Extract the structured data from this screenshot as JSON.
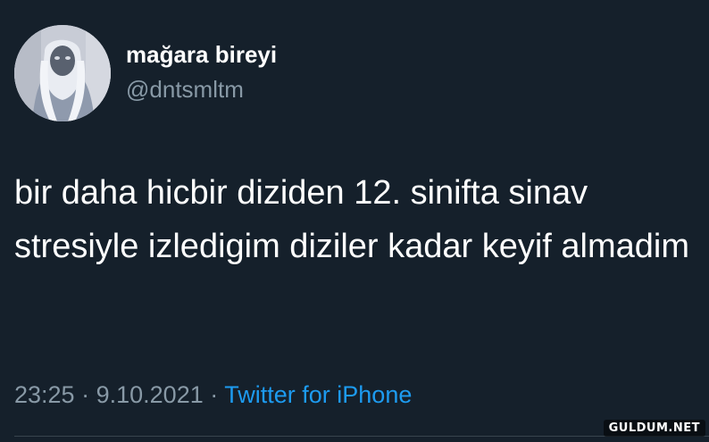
{
  "tweet": {
    "author": {
      "display_name": "mağara bireyi",
      "handle": "@dntsmltm"
    },
    "text": "bir daha hicbir diziden 12. sinifta sinav stresiyle izledigim diziler kadar keyif almadim",
    "time": "23:25",
    "separator": "·",
    "date": "9.10.2021",
    "source": "Twitter for iPhone",
    "source_color": "#1d9bf0"
  },
  "watermark": "GULDUM.NET",
  "colors": {
    "background": "#15202b",
    "text": "#ffffff",
    "secondary_text": "#8899a6",
    "divider": "#38444d"
  }
}
